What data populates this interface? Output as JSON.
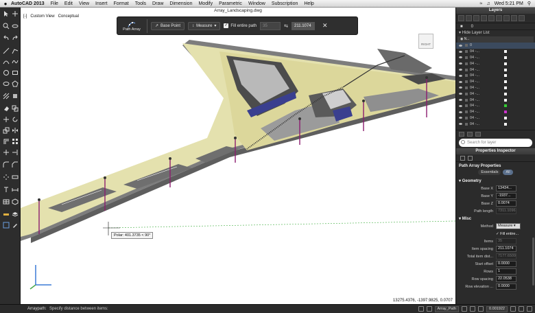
{
  "menubar": {
    "app_name": "AutoCAD 2013",
    "menus": [
      "File",
      "Edit",
      "View",
      "Insert",
      "Format",
      "Tools",
      "Draw",
      "Dimension",
      "Modify",
      "Parametric",
      "Window",
      "Subscription",
      "Help"
    ],
    "clock": "Wed 5:21 PM"
  },
  "document": {
    "title": "Array_Landscaping.dwg",
    "view_name": "Custom View",
    "visual_style": "Conceptual"
  },
  "ribbon": {
    "path_array_label": "Path Array",
    "base_point_label": "Base Point",
    "method_value": "Measure",
    "fill_entire_path_label": "Fill entire path",
    "fill_entire_path_checked": true,
    "items_value": "35",
    "spacing_value": "211.1074",
    "close_glyph": "✕"
  },
  "canvas": {
    "tooltip": "Polar: 401.3735 < 90°",
    "coordinates": "13275.4376, -1397.9825, 0.0707",
    "viewcube_label": "RIGHT"
  },
  "command": {
    "name": "Arraypath:",
    "prompt": "Specify distance between items:",
    "layer_dropdown": "Array_Path",
    "scale_value": "0.001922"
  },
  "layers": {
    "panel_title": "Layers",
    "current_layer": "0",
    "hide_layer_list_label": "Hide Layer List",
    "header_label": "N...",
    "rows": [
      "0",
      "04 -...",
      "04 -...",
      "04 -...",
      "04 -...",
      "04 -...",
      "04 -...",
      "04 -...",
      "04 -...",
      "04 -...",
      "04 -...",
      "04 -...",
      "04 -...",
      "04 -..."
    ],
    "swatch_colors": [
      "",
      "#ffffff",
      "#ffffff",
      "#ffffff",
      "#ffffff",
      "#ffffff",
      "#ffffff",
      "#ffffff",
      "#ffffff",
      "#ffffff",
      "#33cc33",
      "#cc33cc",
      "#ffffff",
      "#ffffff"
    ],
    "search_placeholder": "Search for layer"
  },
  "properties": {
    "panel_title": "Properties Inspector",
    "object_title": "Path Array Properties",
    "tab_essentials": "Essentials",
    "tab_all": "All",
    "geometry_section": "Geometry",
    "misc_section": "Misc",
    "geometry": [
      {
        "label": "Base X",
        "value": "13434..."
      },
      {
        "label": "Base Y",
        "value": "-1937..."
      },
      {
        "label": "Base Z",
        "value": "0.0074"
      },
      {
        "label": "Path length",
        "value": "7311.1096"
      }
    ],
    "method_label": "Method",
    "method_value": "Measure",
    "fill_entire_label": "Fill entire...",
    "misc": [
      {
        "label": "Items",
        "value": "35"
      },
      {
        "label": "Item spacing",
        "value": "211.1074"
      },
      {
        "label": "Total item dist...",
        "value": "7177.6509"
      },
      {
        "label": "Start offset",
        "value": "0.0000"
      },
      {
        "label": "Rows",
        "value": "1"
      },
      {
        "label": "Row spacing",
        "value": "22.0538"
      },
      {
        "label": "Row elevation ...",
        "value": "0.0000"
      }
    ]
  },
  "colors": {
    "ground": "#e4e1ae",
    "curb": "#8c8c8c",
    "pole": "#8c1c6e",
    "canvas_bg": "#ffffff",
    "panel_bg": "#2b2b2b"
  }
}
